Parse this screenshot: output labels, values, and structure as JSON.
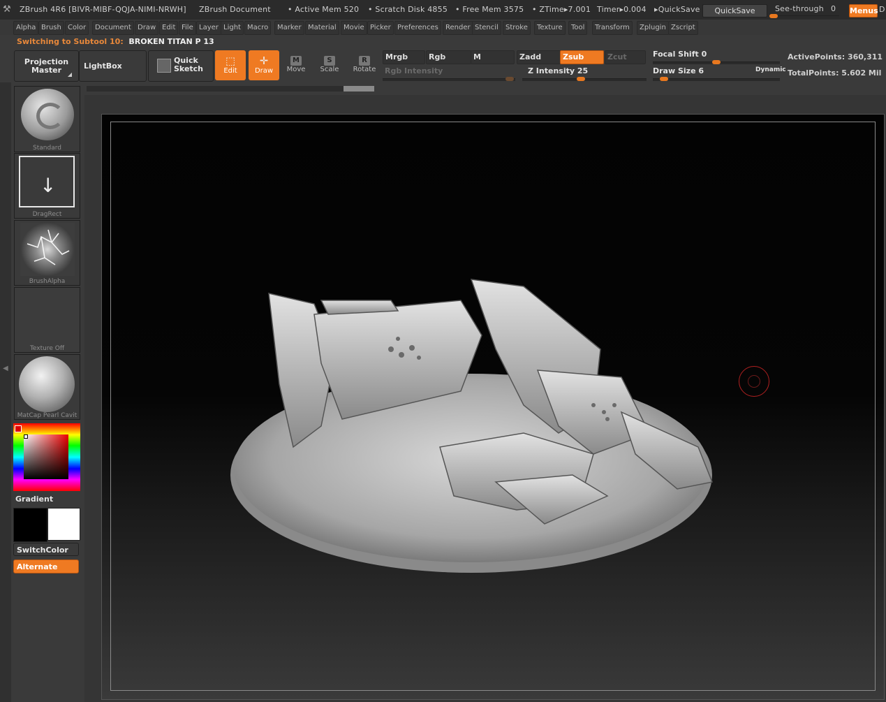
{
  "titlebar": {
    "app_title": "ZBrush 4R6 [BIVR-MIBF-QQJA-NIMI-NRWH]",
    "document": "ZBrush Document",
    "active_mem": "• Active Mem 520",
    "scratch_disk": "• Scratch Disk 4855",
    "free_mem": "• Free Mem 3575",
    "ztime": "• ZTime▸7.001",
    "timer": "Timer▸0.004",
    "quicksave_text": "▸QuickSave",
    "quicksave_button": "QuickSave",
    "see_through_label": "See-through",
    "see_through_value": "0",
    "menus_button": "Menus",
    "default_script": "D"
  },
  "menus": [
    "Alpha",
    "Brush",
    "Color",
    "Document",
    "Draw",
    "Edit",
    "File",
    "Layer",
    "Light",
    "Macro",
    "Marker",
    "Material",
    "Movie",
    "Picker",
    "Preferences",
    "Render",
    "Stencil",
    "Stroke",
    "Texture",
    "Tool",
    "Transform",
    "Zplugin",
    "Zscript"
  ],
  "status": {
    "prefix": "Switching to Subtool 10:",
    "subtool_name": "BROKEN TITAN P 13"
  },
  "toolbar": {
    "projection_master": "Projection\nMaster",
    "lightbox": "LightBox",
    "quick_sketch": "Quick\nSketch",
    "edit": "Edit",
    "draw": "Draw",
    "move": "Move",
    "scale": "Scale",
    "rotate": "Rotate",
    "move_key": "M",
    "scale_key": "S",
    "rotate_key": "R",
    "mrgb": "Mrgb",
    "rgb": "Rgb",
    "m": "M",
    "zadd": "Zadd",
    "zsub": "Zsub",
    "zcut": "Zcut",
    "rgb_intensity": "Rgb Intensity",
    "z_intensity_label": "Z Intensity",
    "z_intensity_value": "25",
    "z_intensity_level": 0.25,
    "focal_shift_label": "Focal Shift",
    "focal_shift_value": "0",
    "focal_shift_level": 0.5,
    "draw_size_label": "Draw Size",
    "draw_size_value": "6",
    "draw_size_level": 0.06,
    "dynamic": "Dynamic",
    "active_points": "ActivePoints: 360,311",
    "total_points": "TotalPoints: 5.602  Mil"
  },
  "shelf": {
    "brush": "Standard",
    "stroke": "DragRect",
    "alpha": "BrushAlpha",
    "texture": "Texture  Off",
    "material": "MatCap  Pearl  Cavit",
    "gradient": "Gradient",
    "switch_color": "SwitchColor",
    "alternate": "Alternate"
  },
  "colors": {
    "accent": "#ef7a22",
    "primary_color": "#000000",
    "secondary_color": "#ffffff"
  }
}
